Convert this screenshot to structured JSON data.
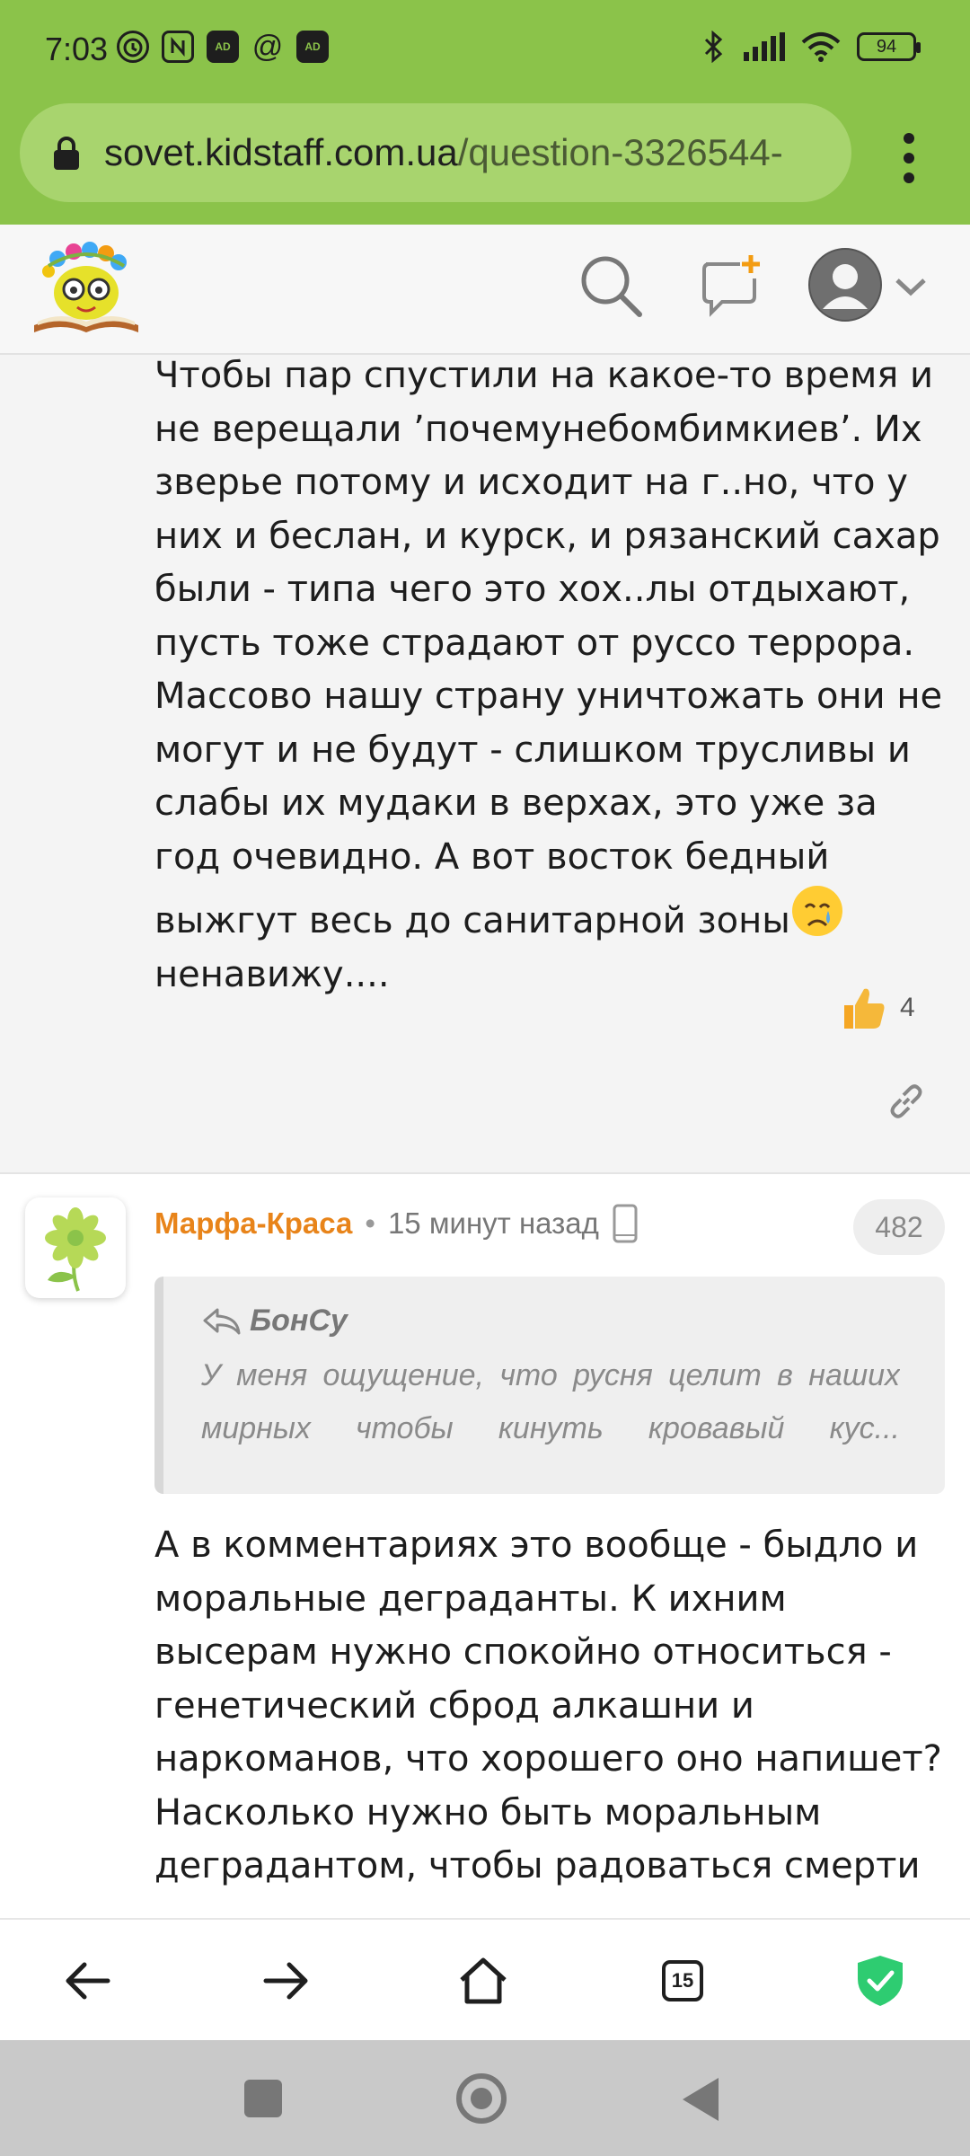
{
  "status_bar": {
    "time": "7:03",
    "left_icons": [
      "alarm-icon",
      "nfc-icon",
      "adblock-icon",
      "at-icon",
      "adblock-icon"
    ],
    "ad_label": "AD",
    "at_label": "@",
    "right_icons": [
      "bluetooth-icon",
      "signal-icon",
      "wifi-icon",
      "battery-icon"
    ],
    "battery": "94"
  },
  "browser": {
    "url_host": "sovet.kidstaff.com.ua",
    "url_path": "/question-3326544-"
  },
  "header": {
    "icons": [
      "site-logo",
      "search-icon",
      "new-topic-icon",
      "user-avatar-icon",
      "chevron-down-icon"
    ]
  },
  "post1": {
    "text": "Чтобы пар спустили на какое-то время и не верещали ’почемунебомбимкиев’. Их зверье потому и исходит на г..но, что у них и беслан, и курск, и рязанский сахар были - типа чего это хох..лы отдыхают, пусть тоже страдают от руссо террора. Массово нашу страну уничтожать они не могут и не будут - слишком трусливы и слабы их мудаки в верхах, это уже за год очевидно. А вот восток бедный выжгут весь до санитарной зоны",
    "text_tail": " ненавижу....",
    "emoji": "crying-face",
    "likes": "4"
  },
  "post2": {
    "author": "Марфа-Краса",
    "separator": "•",
    "time_ago": "15 минут назад",
    "device": "mobile-icon",
    "post_count": "482",
    "quote_author": "БонСу",
    "quote_text": "У меня ощущение, что русня целит в наших мирных чтобы кинуть кровавый кус...",
    "text": "А в комментариях это вообще - быдло и моральные деграданты. К ихним высерам нужно спокойно относиться - генетический сброд алкашни и наркоманов, что хорошего оно напишет? Насколько нужно быть моральным деградантом, чтобы радоваться смерти"
  },
  "bottom_nav": {
    "tabs_count": "15",
    "icons": [
      "back-arrow-icon",
      "forward-arrow-icon",
      "home-icon",
      "tabs-icon",
      "shield-check-icon"
    ]
  },
  "colors": {
    "accent_green": "#8bc34a",
    "author_orange": "#e8841a",
    "shield_green": "#2ecc71"
  }
}
